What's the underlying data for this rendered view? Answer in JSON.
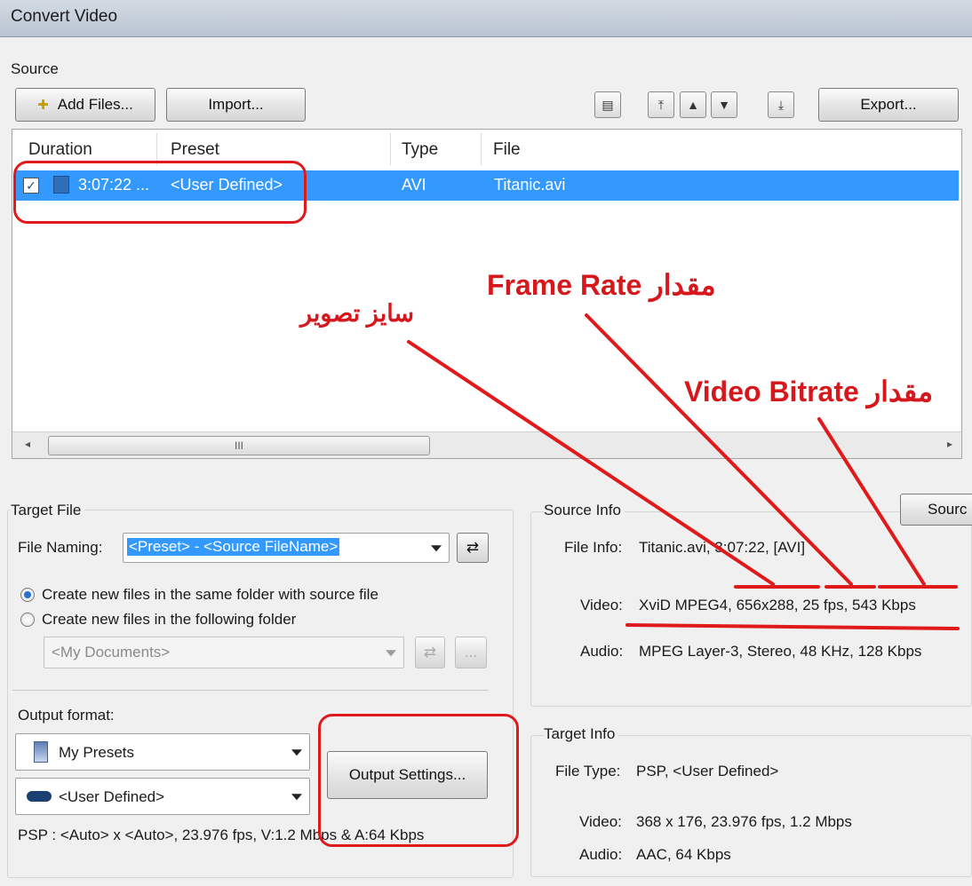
{
  "window": {
    "title": "Convert Video"
  },
  "source": {
    "label": "Source",
    "add_files": "Add Files...",
    "import": "Import...",
    "export": "Export...",
    "columns": [
      "Duration",
      "Preset",
      "Type",
      "File"
    ],
    "rows": [
      {
        "checked": true,
        "duration": "3:07:22 ...",
        "preset": "<User Defined>",
        "type": "AVI",
        "file": "Titanic.avi"
      }
    ],
    "scroll_grip": "III"
  },
  "target_file": {
    "label": "Target File",
    "file_naming_label": "File Naming:",
    "file_naming_value": "<Preset> - <Source FileName>",
    "radio_same": "Create new files in the same folder with source file",
    "radio_other": "Create new files in the following folder",
    "folder_value": "<My Documents>",
    "folder_browse": "..."
  },
  "output": {
    "label": "Output format:",
    "presets_value": "My Presets",
    "preset_value": "<User Defined>",
    "settings_button": "Output Settings...",
    "summary": "PSP : <Auto> x <Auto>, 23.976 fps, V:1.2 Mbps & A:64 Kbps"
  },
  "source_info": {
    "label": "Source Info",
    "button_partial": "Sourc",
    "file_info_label": "File Info:",
    "file_info_value": "Titanic.avi, 3:07:22,  [AVI]",
    "video_label": "Video:",
    "video_value": "XviD MPEG4, 656x288, 25 fps, 543 Kbps",
    "audio_label": "Audio:",
    "audio_value": "MPEG Layer-3, Stereo, 48 KHz, 128 Kbps"
  },
  "target_info": {
    "label": "Target Info",
    "file_type_label": "File Type:",
    "file_type_value": "PSP, <User Defined>",
    "video_label": "Video:",
    "video_value": "368 x 176, 23.976 fps, 1.2 Mbps",
    "audio_label": "Audio:",
    "audio_value": "AAC, 64 Kbps"
  },
  "annotations": {
    "frame_rate": "مقدار Frame Rate",
    "image_size": "سایز تصویر",
    "video_bitrate": "مقدار Video Bitrate"
  },
  "colors": {
    "accent": "#3399ff",
    "annotation": "#d6181d"
  }
}
